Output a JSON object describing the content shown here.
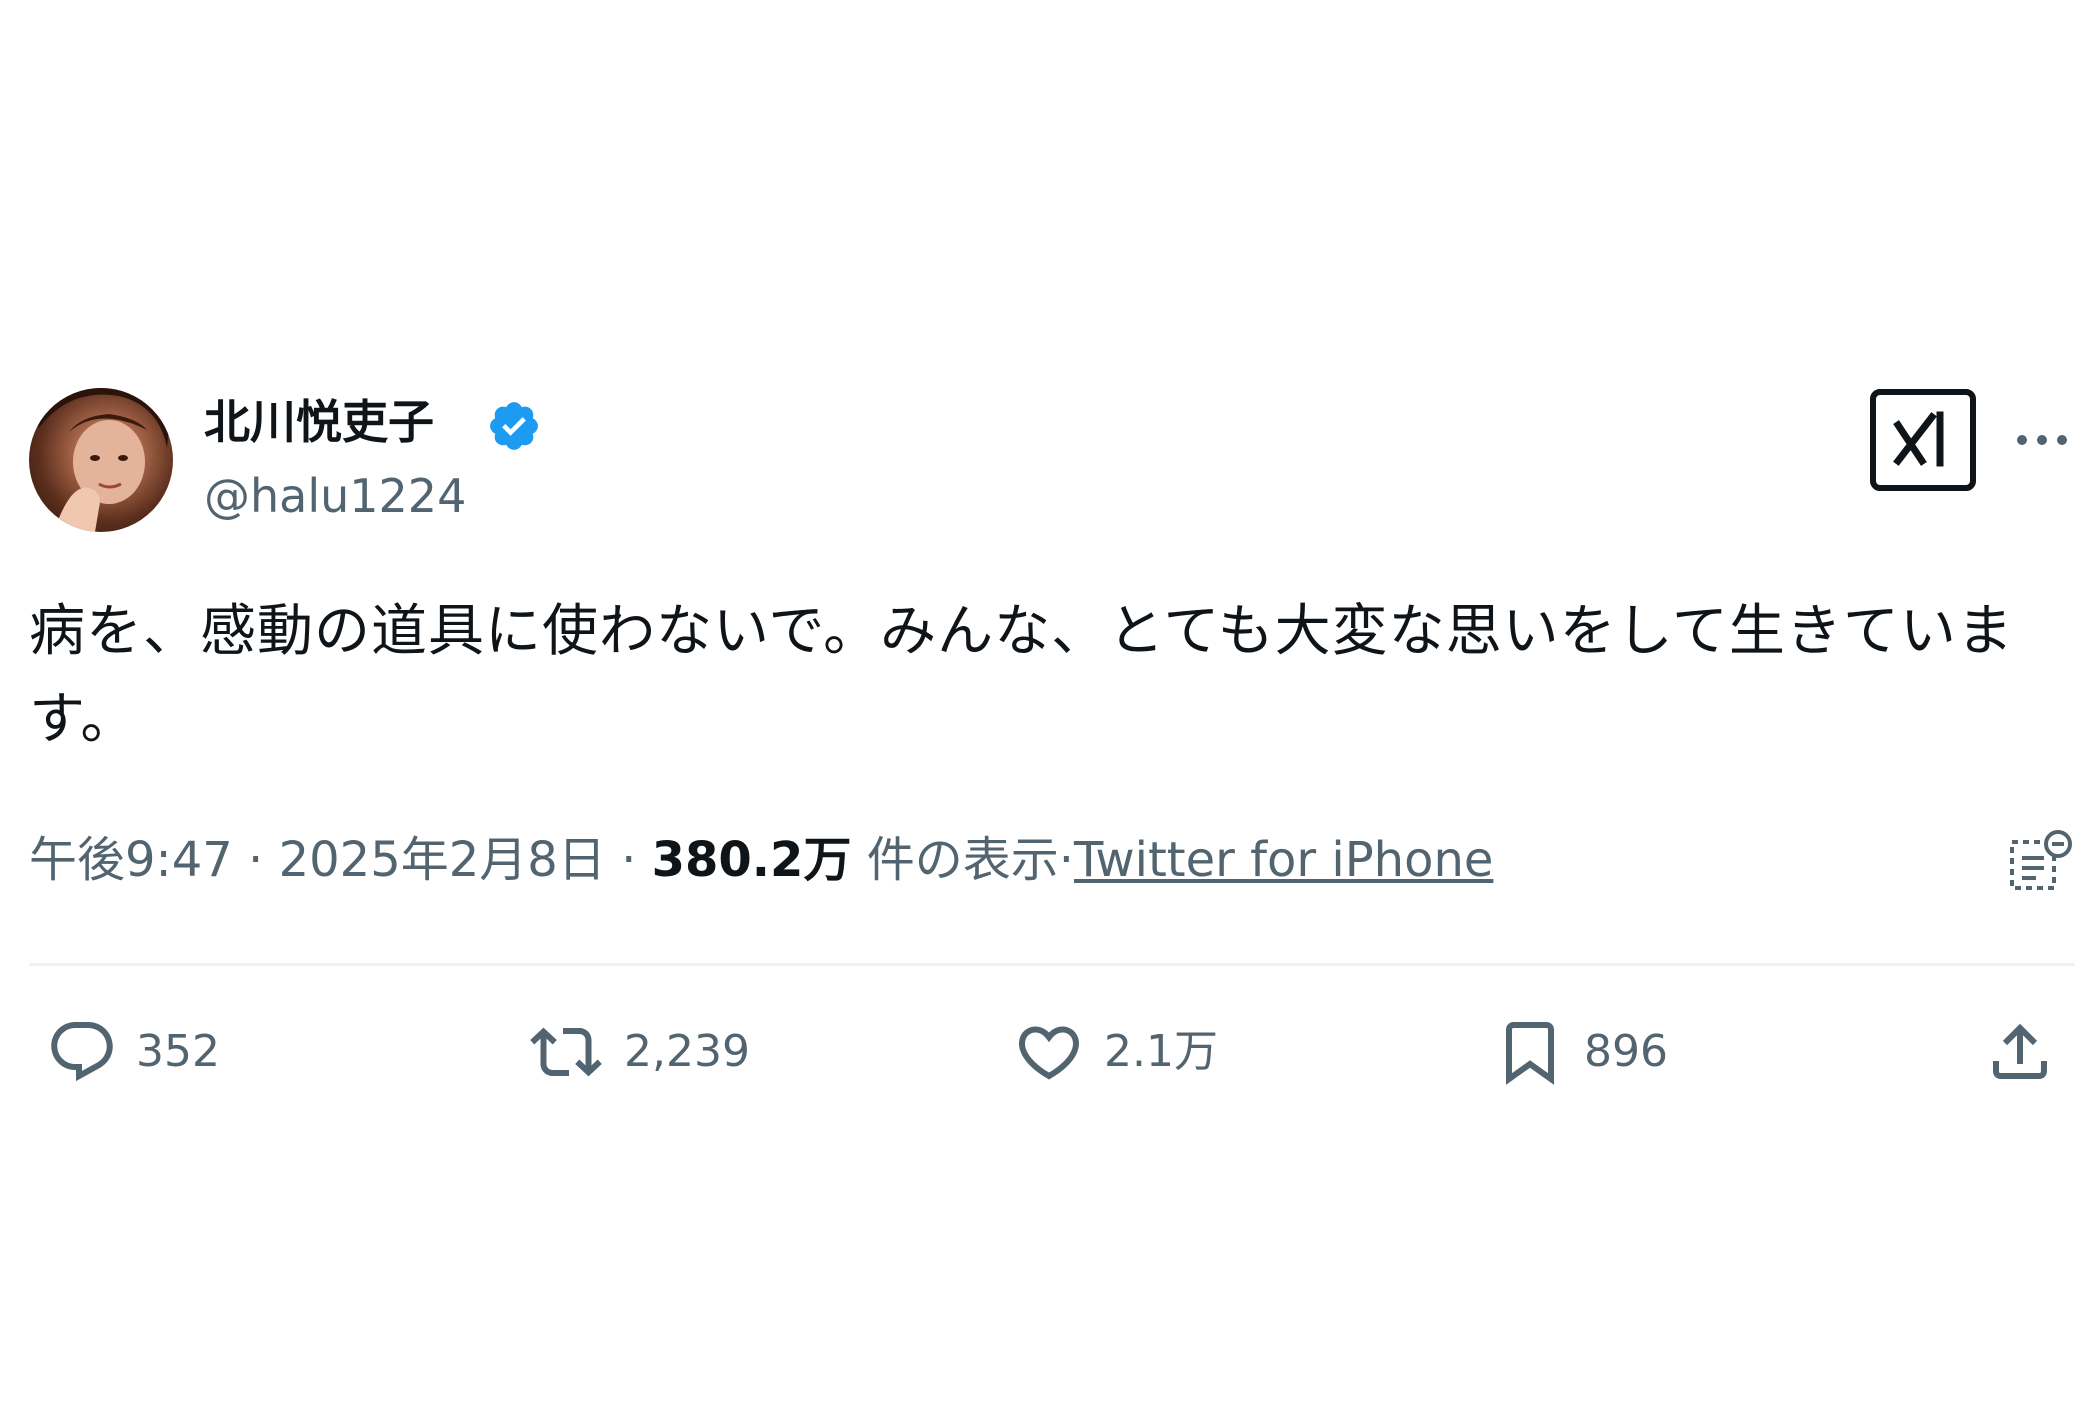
{
  "author": {
    "display_name": "北川悦吏子",
    "handle": "@halu1224",
    "verified": true
  },
  "tweet": {
    "text": "病を、感動の道具に使わないで。みんな、とても大変な思いをして生きています。"
  },
  "meta": {
    "time": "午後9:47",
    "separator1": " · ",
    "date": "2025年2月8日",
    "separator2": " · ",
    "views_count": "380.2万",
    "views_label": " 件の表示",
    "separator3": "·",
    "source": "Twitter for iPhone"
  },
  "actions": {
    "reply_count": "352",
    "retweet_count": "2,239",
    "like_count": "2.1万",
    "bookmark_count": "896"
  },
  "icons": {
    "verified": "verified-badge-icon",
    "grok": "grok-icon",
    "more": "more-icon",
    "analytics": "analytics-icon",
    "reply": "reply-icon",
    "retweet": "retweet-icon",
    "like": "like-icon",
    "bookmark": "bookmark-icon",
    "share": "share-icon"
  },
  "colors": {
    "text": "#0f1419",
    "secondary": "#536471",
    "verified": "#1d9bf0",
    "divider": "#eff3f4"
  }
}
